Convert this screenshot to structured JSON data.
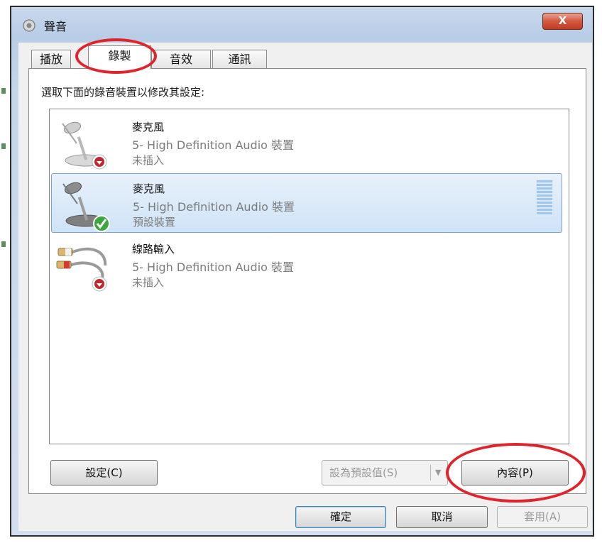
{
  "window": {
    "title": "聲音",
    "close_label": "X"
  },
  "tabs": [
    {
      "label": "播放"
    },
    {
      "label": "錄製",
      "selected": true
    },
    {
      "label": "音效"
    },
    {
      "label": "通訊"
    }
  ],
  "instruction": "選取下面的錄音裝置以修改其設定:",
  "devices": [
    {
      "name": "麥克風",
      "description": "5- High Definition Audio 裝置",
      "status": "未插入",
      "icon": "microphone-icon",
      "badge": "unplugged-icon"
    },
    {
      "name": "麥克風",
      "description": "5- High Definition Audio 裝置",
      "status": "預設裝置",
      "icon": "microphone-icon",
      "badge": "default-check-icon",
      "selected": true
    },
    {
      "name": "線路輸入",
      "description": "5- High Definition Audio 裝置",
      "status": "未插入",
      "icon": "line-in-cable-icon",
      "badge": "unplugged-icon"
    }
  ],
  "buttons": {
    "configure": "設定(C)",
    "set_default": "設為預設值(S)",
    "properties": "內容(P)",
    "ok": "確定",
    "cancel": "取消",
    "apply": "套用(A)"
  },
  "colors": {
    "annotation": "#e0242c",
    "selection": "#cfe3f7",
    "close_button": "#c23b22",
    "level_meter": "#9ec7ec"
  }
}
